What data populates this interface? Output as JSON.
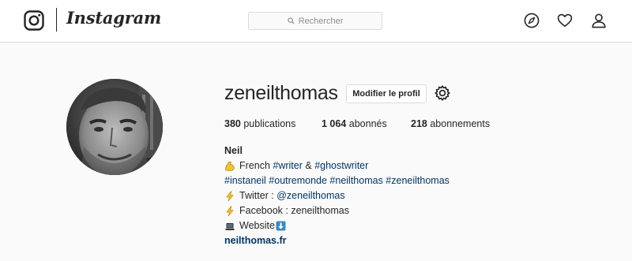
{
  "header": {
    "logo_text": "Instagram",
    "search_placeholder": "Rechercher",
    "icons": [
      "instagram-glyph-icon",
      "search-icon",
      "compass-icon",
      "heart-icon",
      "user-icon"
    ]
  },
  "profile": {
    "username": "zeneilthomas",
    "edit_profile_label": "Modifier le profil",
    "settings_icon": "gear-icon",
    "stats": [
      {
        "value": "380",
        "label": "publications"
      },
      {
        "value": "1 064",
        "label": "abonnés"
      },
      {
        "value": "218",
        "label": "abonnements"
      }
    ],
    "bio": {
      "full_name": "Neil",
      "line1_pre": "French ",
      "line1_tag1": "#writer",
      "line1_mid": " & ",
      "line1_tag2": "#ghostwriter",
      "line2_tags": "#instaneil #outremonde #neilthomas #zeneilthomas",
      "line3_pre": "Twitter : ",
      "line3_handle": "@zeneilthomas",
      "line4": "Facebook : zeneilthomas",
      "line5": "Website",
      "website": "neilthomas.fr"
    }
  },
  "colors": {
    "background": "#fafafa",
    "topbar": "#ffffff",
    "border": "#dbdbdb",
    "text": "#262626",
    "link": "#003569",
    "muted": "#8e8e8e"
  }
}
